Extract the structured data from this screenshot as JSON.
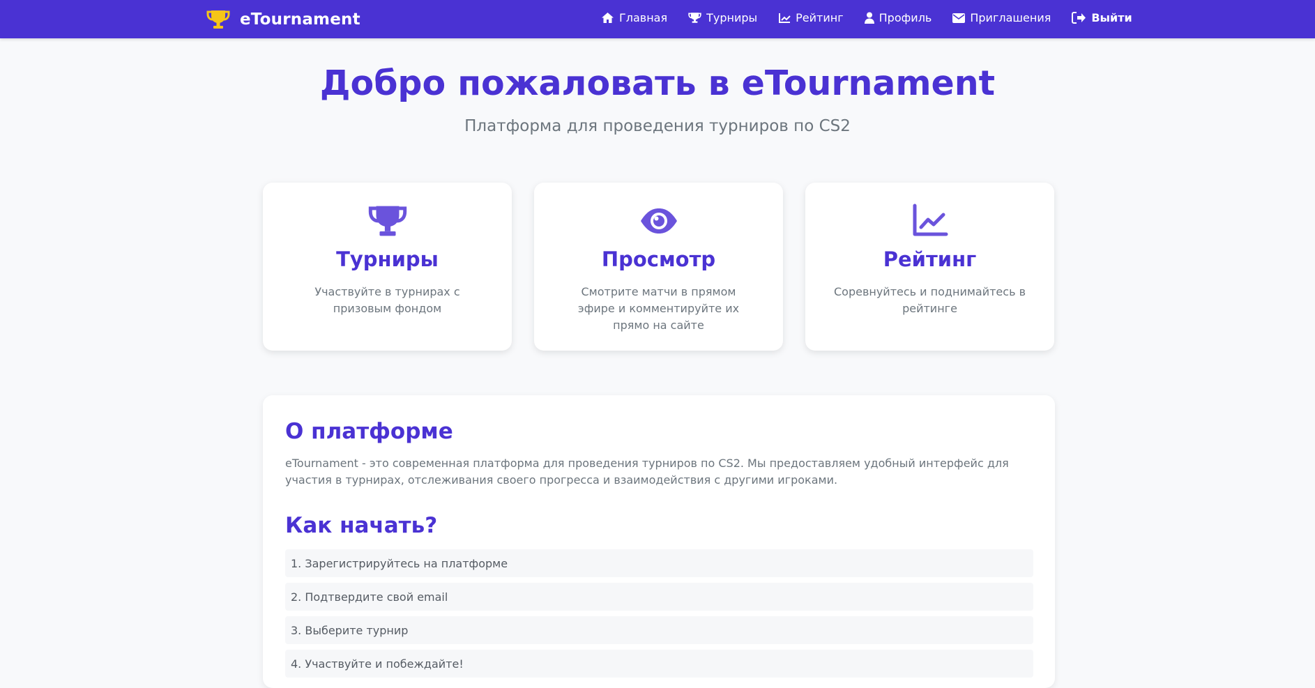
{
  "header": {
    "brand": "eTournament",
    "nav": [
      {
        "label": "Главная",
        "icon": "home-icon"
      },
      {
        "label": "Турниры",
        "icon": "trophy-icon"
      },
      {
        "label": "Рейтинг",
        "icon": "chart-line-icon"
      },
      {
        "label": "Профиль",
        "icon": "user-icon"
      },
      {
        "label": "Приглашения",
        "icon": "envelope-icon"
      },
      {
        "label": "Выйти",
        "icon": "sign-out-icon"
      }
    ]
  },
  "hero": {
    "title": "Добро пожаловать в eTournament",
    "subtitle": "Платформа для проведения турниров по CS2"
  },
  "features": [
    {
      "icon": "trophy-icon",
      "title": "Турниры",
      "text": "Участвуйте в турнирах с призовым фондом"
    },
    {
      "icon": "eye-icon",
      "title": "Просмотр",
      "text": "Смотрите матчи в прямом эфире и комментируйте их прямо на сайте"
    },
    {
      "icon": "chart-line-icon",
      "title": "Рейтинг",
      "text": "Соревнуйтесь и поднимайтесь в рейтинге"
    }
  ],
  "about": {
    "title": "О платформе",
    "description": "eTournament - это современная платформа для проведения турниров по CS2. Мы предоставляем удобный интерфейс для участия в турнирах, отслеживания своего прогресса и взаимодействия с другими игроками.",
    "steps_title": "Как начать?",
    "steps": [
      "1. Зарегистрируйтесь на платформе",
      "2. Подтвердите свой email",
      "3. Выберите турнир",
      "4. Участвуйте и побеждайте!"
    ]
  },
  "colors": {
    "primary": "#4a32d3",
    "icon": "#6a53dc",
    "brand_icon": "#f6c518",
    "background": "#f8f9fb",
    "muted_text": "#6c757d"
  }
}
